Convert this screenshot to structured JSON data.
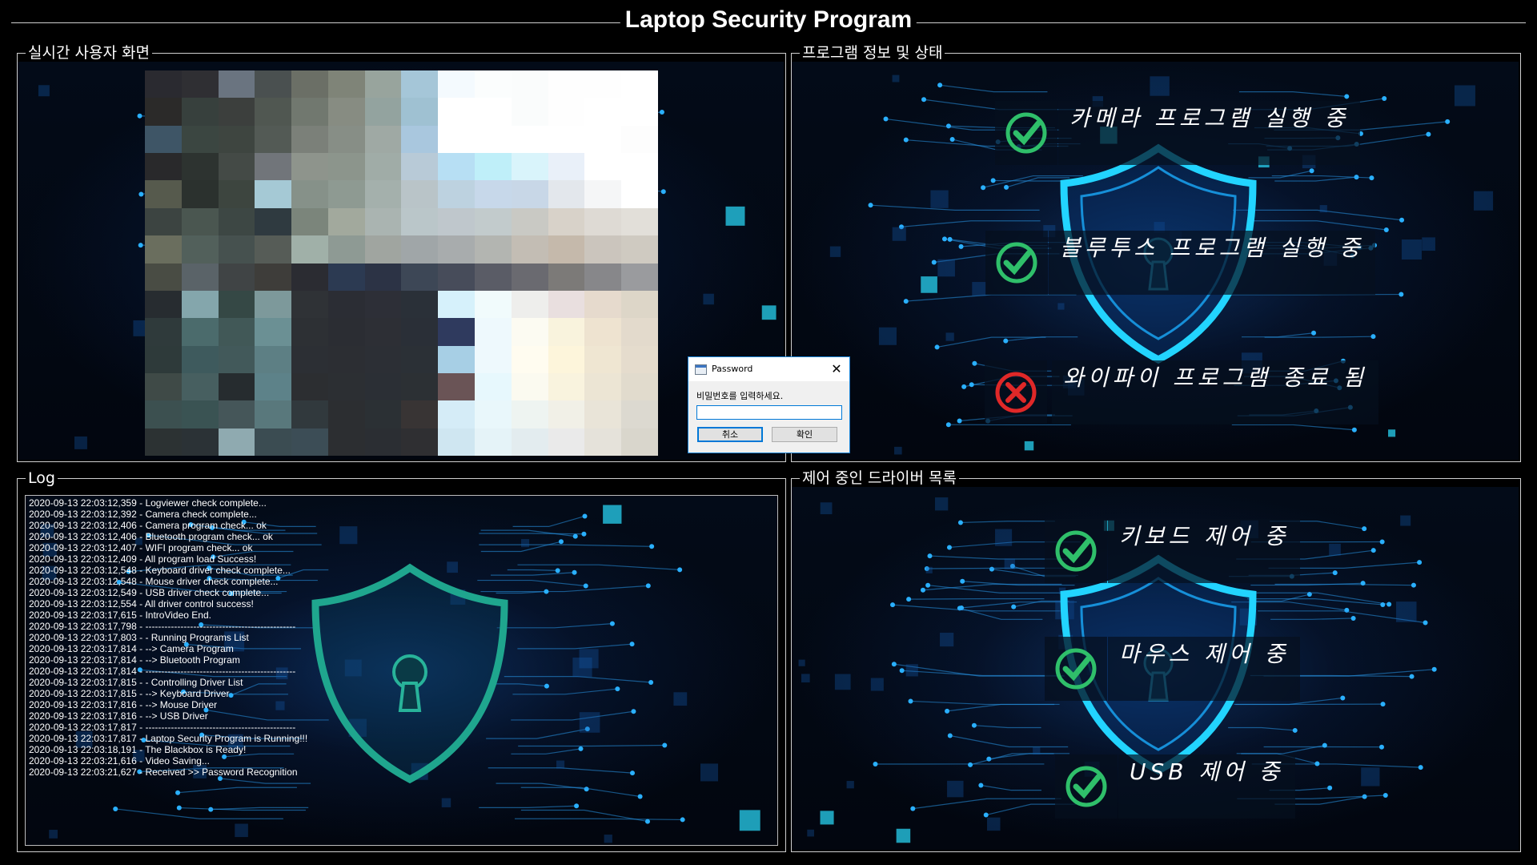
{
  "window_title": "Laptop Security Program",
  "panels": {
    "live_screen": {
      "title": "실시간 사용자 화면"
    },
    "program_status": {
      "title": "프로그램 정보 및 상태",
      "items": [
        {
          "label": "카메라 프로그램 실행 중",
          "status": "ok",
          "icon": "check-icon"
        },
        {
          "label": "블루투스 프로그램 실행 중",
          "status": "ok",
          "icon": "check-icon"
        },
        {
          "label": "와이파이 프로그램 종료 됨",
          "status": "error",
          "icon": "x-icon"
        }
      ]
    },
    "log": {
      "title": "Log",
      "lines": [
        "2020-09-13 22:03:12,359 - Logviewer check complete...",
        "2020-09-13 22:03:12,392 - Camera check complete...",
        "2020-09-13 22:03:12,406 - Camera program check... ok",
        "2020-09-13 22:03:12,406 - Bluetooth program check... ok",
        "2020-09-13 22:03:12,407 - WIFI program check... ok",
        "2020-09-13 22:03:12,409 - All program load Success!",
        "2020-09-13 22:03:12,548 - Keyboard driver check complete...",
        "2020-09-13 22:03:12,548 - Mouse driver check complete...",
        "2020-09-13 22:03:12,549 - USB driver check complete...",
        "2020-09-13 22:03:12,554 - All driver control success!",
        "2020-09-13 22:03:17,615 - IntroVideo End.",
        "2020-09-13 22:03:17,798 - -----------------------------------------------",
        "2020-09-13 22:03:17,803 - - Running Programs List",
        "2020-09-13 22:03:17,814 - --> Camera Program",
        "2020-09-13 22:03:17,814 - --> Bluetooth Program",
        "2020-09-13 22:03:17,814 - -----------------------------------------------",
        "2020-09-13 22:03:17,815 - - Controlling Driver List",
        "2020-09-13 22:03:17,815 - --> Keyboard Driver",
        "2020-09-13 22:03:17,816 - --> Mouse Driver",
        "2020-09-13 22:03:17,816 - --> USB Driver",
        "2020-09-13 22:03:17,817 - -----------------------------------------------",
        "2020-09-13 22:03:17,817 - Laptop Security Program is Running!!!",
        "2020-09-13 22:03:18,191 - The Blackbox is Ready!",
        "2020-09-13 22:03:21,616 - Video Saving...",
        "2020-09-13 22:03:21,627 - Received >> Password Recognition"
      ]
    },
    "drivers": {
      "title": "제어 중인 드라이버 목록",
      "items": [
        {
          "label": "키보드 제어 중",
          "status": "ok",
          "icon": "check-icon"
        },
        {
          "label": "마우스 제어 중",
          "status": "ok",
          "icon": "check-icon"
        },
        {
          "label": "USB 제어 중",
          "status": "ok",
          "icon": "check-icon"
        }
      ]
    }
  },
  "dialog": {
    "title": "Password",
    "prompt": "비밀번호를 입력하세요.",
    "input_value": "",
    "cancel_label": "취소",
    "ok_label": "확인",
    "close_glyph": "✕"
  },
  "colors": {
    "ok": "#2fbf6a",
    "error": "#e02828",
    "accent": "#1ec8ff"
  }
}
